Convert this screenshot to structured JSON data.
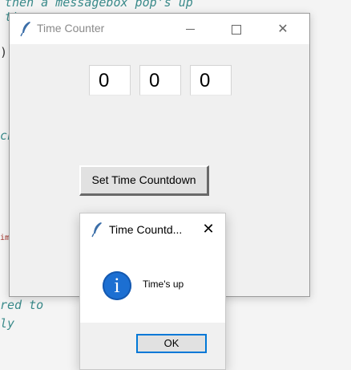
{
  "background_code": {
    "line1": "then a messagebox pop's up",
    "line2": "t'",
    "line3": ")(",
    "line4": "ch",
    "line5": "im",
    "line6": "red to",
    "line7": "ly"
  },
  "main_window": {
    "title": "Time Counter",
    "time_fields": [
      "0",
      "0",
      "0"
    ],
    "set_button_label": "Set Time Countdown"
  },
  "message_box": {
    "title": "Time Countd...",
    "message": "Time's up",
    "ok_label": "OK"
  },
  "colors": {
    "code_teal": "#3a8a8a",
    "info_blue": "#1c6fd2",
    "focus_blue": "#0078d7"
  }
}
